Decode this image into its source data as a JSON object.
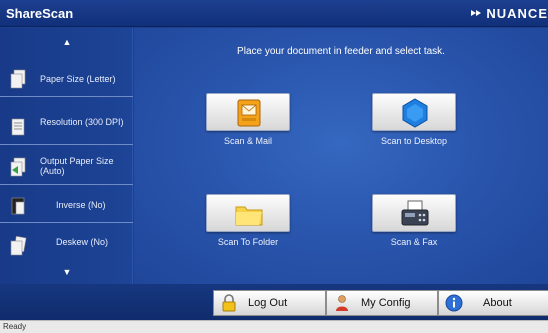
{
  "app": {
    "title": "ShareScan",
    "brand": "NUANCE"
  },
  "sidebar": {
    "items": [
      {
        "label": "Paper Size (Letter)",
        "icon": "paper-size-icon"
      },
      {
        "label": "Resolution (300 DPI)",
        "icon": "resolution-icon"
      },
      {
        "label": "Output Paper Size (Auto)",
        "icon": "output-paper-size-icon"
      },
      {
        "label": "Inverse (No)",
        "icon": "inverse-icon"
      },
      {
        "label": "Deskew (No)",
        "icon": "deskew-icon"
      }
    ]
  },
  "main": {
    "instruction": "Place your document in feeder and select task.",
    "tasks": [
      {
        "label": "Scan & Mail",
        "icon": "mail-icon"
      },
      {
        "label": "Scan to Desktop",
        "icon": "desktop-icon"
      },
      {
        "label": "Scan To Folder",
        "icon": "folder-icon"
      },
      {
        "label": "Scan & Fax",
        "icon": "fax-icon"
      }
    ]
  },
  "footer": {
    "logout": "Log Out",
    "myconfig": "My Config",
    "about": "About"
  },
  "status": {
    "text": "Ready"
  },
  "colors": {
    "background": "#1b3f91",
    "accent": "#2a56ae",
    "tile": "#f0f0f0"
  }
}
